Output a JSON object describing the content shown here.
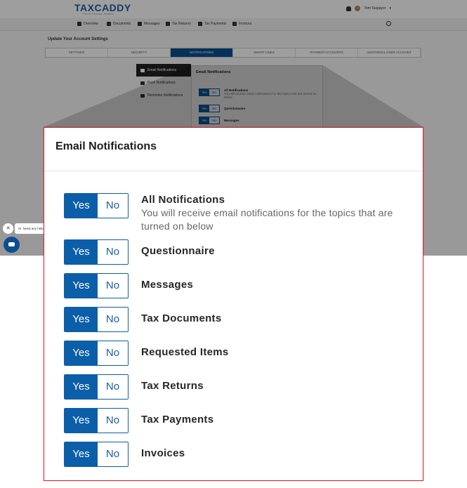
{
  "app": {
    "logo": "TAXCADDY",
    "logo_sub": "Part of Thomson Reuters",
    "user_name": "Tom Taxpayer",
    "nav": [
      {
        "label": "Overview",
        "icon": "home-icon"
      },
      {
        "label": "Documents",
        "icon": "documents-icon"
      },
      {
        "label": "Messages",
        "icon": "messages-icon"
      },
      {
        "label": "Tax Returns",
        "icon": "tax-returns-icon"
      },
      {
        "label": "Tax Payments",
        "icon": "tax-payments-icon"
      },
      {
        "label": "Invoices",
        "icon": "invoices-icon"
      }
    ],
    "settings_title": "Update Your Account Settings",
    "tabs": [
      "SETTINGS",
      "SECURITY",
      "NOTIFICATIONS",
      "SMART LINKS",
      "PAYMENT ACCOUNTS",
      "ADDITIONAL USER ACCOUNT"
    ],
    "active_tab": "NOTIFICATIONS",
    "side_menu": [
      {
        "label": "Email Notifications",
        "icon": "mail-icon",
        "active": true
      },
      {
        "label": "Push Notifications",
        "icon": "bell-icon",
        "active": false
      },
      {
        "label": "Reminder Notifications",
        "icon": "clock-icon",
        "active": false
      }
    ],
    "chat_text": "Hi. Need any help?",
    "chat_close": "✕"
  },
  "panel": {
    "title": "Email Notifications",
    "yes_label": "Yes",
    "no_label": "No",
    "rows": [
      {
        "label": "All Notifications",
        "description": "You will receive email notifications for the topics that are turned on below",
        "value": "Yes"
      },
      {
        "label": "Questionnaire",
        "value": "Yes"
      },
      {
        "label": "Messages",
        "value": "Yes"
      },
      {
        "label": "Tax Documents",
        "value": "Yes"
      },
      {
        "label": "Requested Items",
        "value": "Yes"
      },
      {
        "label": "Tax Returns",
        "value": "Yes"
      },
      {
        "label": "Tax Payments",
        "value": "Yes"
      },
      {
        "label": "Invoices",
        "value": "Yes"
      }
    ]
  },
  "colors": {
    "accent": "#0b5ea8",
    "highlight_border": "#d4202d"
  }
}
